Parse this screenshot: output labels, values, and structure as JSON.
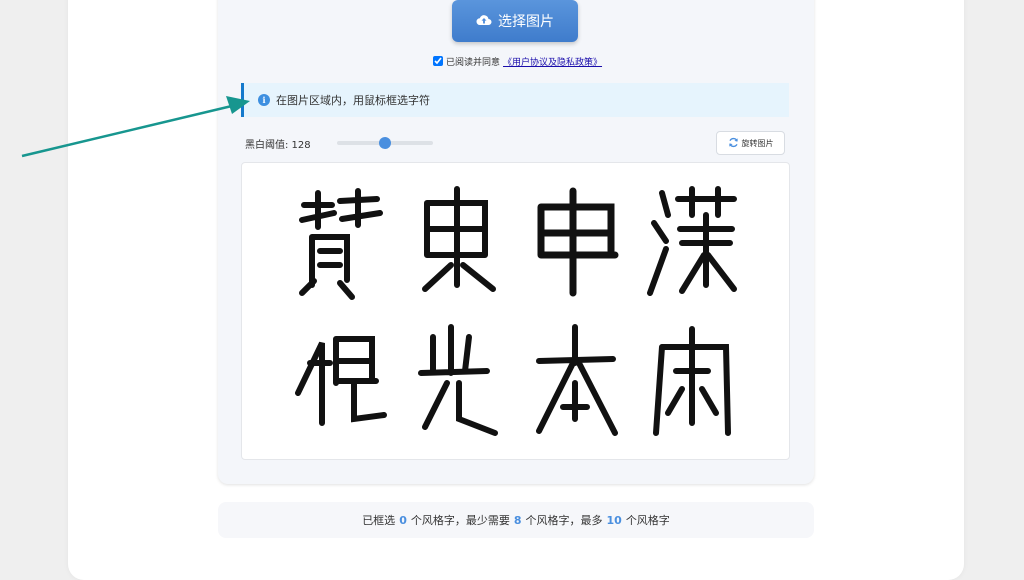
{
  "upload": {
    "button_label": "选择图片",
    "icon": "cloud-upload-icon"
  },
  "agreement": {
    "checked": true,
    "prefix": "已阅读并同意",
    "link_text": "《用户协议及隐私政策》"
  },
  "info": {
    "icon": "info-icon",
    "text": "在图片区域内，用鼠标框选字符"
  },
  "threshold": {
    "label": "黑白阈值: 128",
    "value": 128,
    "max": 255
  },
  "rotate": {
    "label": "旋转图片",
    "icon": "refresh-icon"
  },
  "image": {
    "description_icon": "calligraphy-image",
    "glyph_count": 8
  },
  "footer": {
    "part1": "已框选",
    "selected": "0",
    "part2": "个风格字，最少需要",
    "min": "8",
    "part3": "个风格字，最多",
    "max": "10",
    "part4": "个风格字"
  },
  "colors": {
    "primary": "#4a8fdf",
    "info_border": "#1479cc",
    "annotation_arrow": "#17968f"
  }
}
